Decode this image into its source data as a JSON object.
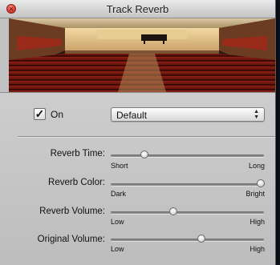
{
  "window": {
    "title": "Track Reverb"
  },
  "controls": {
    "on_label": "On",
    "on_checked": true,
    "preset_value": "Default"
  },
  "params": [
    {
      "label": "Reverb Time:",
      "min_label": "Short",
      "max_label": "Long",
      "value": 0.22
    },
    {
      "label": "Reverb Color:",
      "min_label": "Dark",
      "max_label": "Bright",
      "value": 0.98
    },
    {
      "label": "Reverb Volume:",
      "min_label": "Low",
      "max_label": "High",
      "value": 0.41
    },
    {
      "label": "Original Volume:",
      "min_label": "Low",
      "max_label": "High",
      "value": 0.59
    }
  ]
}
